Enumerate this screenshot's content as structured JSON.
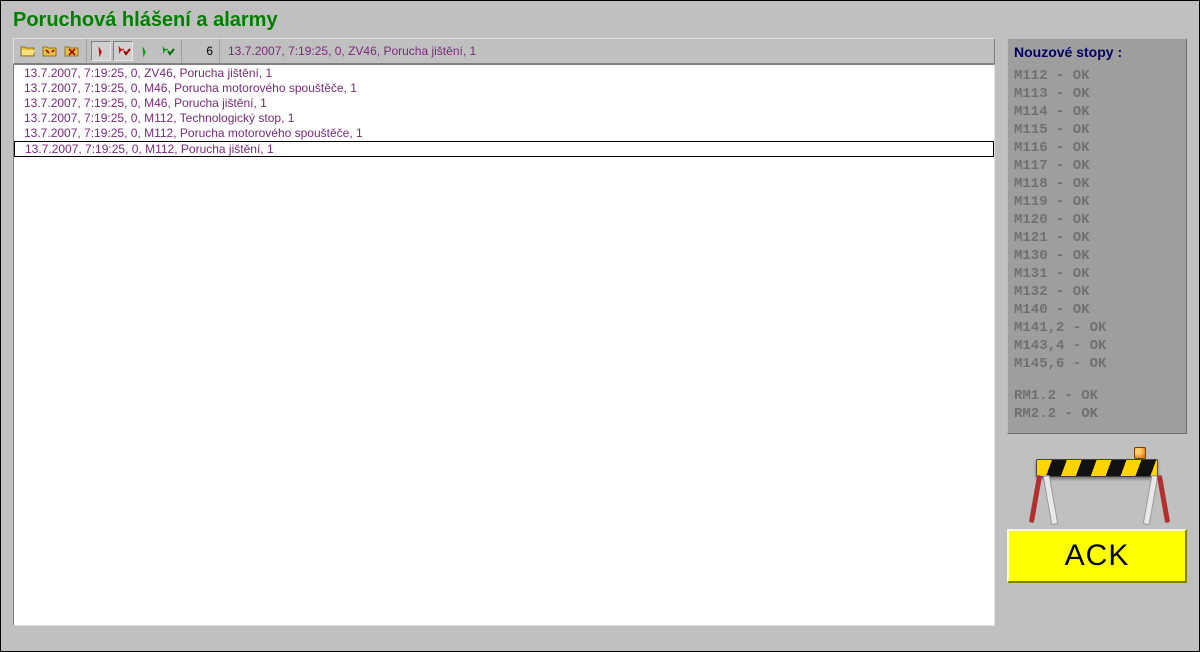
{
  "title": "Poruchová hlášení a alarmy",
  "toolbar": {
    "icons": [
      "folder-open",
      "folder-archive",
      "folder-cancel",
      "pin-red",
      "pin-red-check",
      "pin-green",
      "pin-green-check"
    ],
    "count": "6",
    "status": "13.7.2007, 7:19:25, 0, ZV46, Porucha jištění, 1"
  },
  "alarms": [
    {
      "text": "13.7.2007, 7:19:25, 0, ZV46, Porucha jištění, 1",
      "selected": false
    },
    {
      "text": "13.7.2007, 7:19:25, 0, M46, Porucha motorového spouštěče, 1",
      "selected": false
    },
    {
      "text": "13.7.2007, 7:19:25, 0, M46, Porucha jištění, 1",
      "selected": false
    },
    {
      "text": "13.7.2007, 7:19:25, 0, M112, Technologický stop, 1",
      "selected": false
    },
    {
      "text": "13.7.2007, 7:19:25, 0, M112, Porucha motorového spouštěče, 1",
      "selected": false
    },
    {
      "text": "13.7.2007, 7:19:25, 0, M112, Porucha jištění, 1",
      "selected": true
    }
  ],
  "stops": {
    "title": "Nouzové stopy :",
    "group1": [
      "M112 - OK",
      "M113 - OK",
      "M114 - OK",
      "M115 - OK",
      "M116 - OK",
      "M117 - OK",
      "M118 - OK",
      "M119 - OK",
      "M120 - OK",
      "M121 - OK",
      "M130 - OK",
      "M131 - OK",
      "M132 - OK",
      "M140 - OK",
      "M141,2 - OK",
      "M143,4 - OK",
      "M145,6 - OK"
    ],
    "group2": [
      "RM1.2 - OK",
      "RM2.2 - OK"
    ]
  },
  "ack_label": "ACK"
}
